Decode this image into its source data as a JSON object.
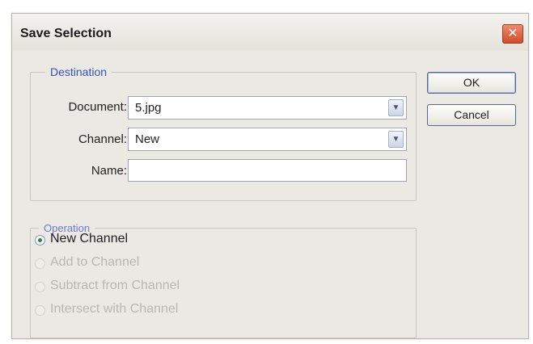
{
  "dialog": {
    "title": "Save Selection",
    "close_icon": "close-icon"
  },
  "destination": {
    "legend": "Destination",
    "document_label": "Document:",
    "document_value": "5.jpg",
    "channel_label": "Channel:",
    "channel_value": "New",
    "name_label": "Name:",
    "name_value": ""
  },
  "operation": {
    "legend": "Operation",
    "options": [
      {
        "label": "New Channel",
        "selected": true,
        "enabled": true
      },
      {
        "label": "Add to Channel",
        "selected": false,
        "enabled": false
      },
      {
        "label": "Subtract from Channel",
        "selected": false,
        "enabled": false
      },
      {
        "label": "Intersect with Channel",
        "selected": false,
        "enabled": false
      }
    ]
  },
  "buttons": {
    "ok": "OK",
    "cancel": "Cancel"
  },
  "colors": {
    "dialog_bg": "#ebe9e3",
    "legend_text": "#3b4fb5",
    "close_button": "#d2492c"
  }
}
